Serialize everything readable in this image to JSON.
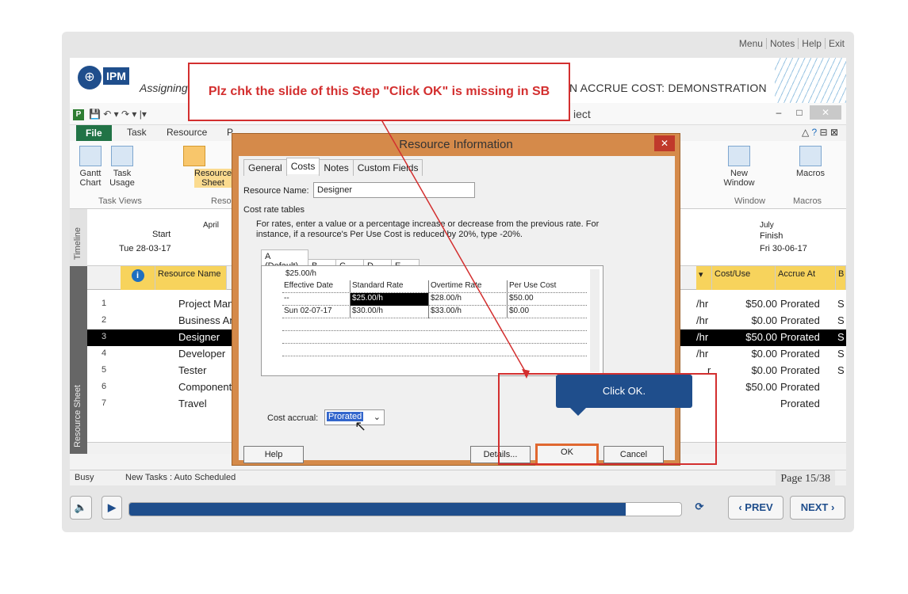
{
  "player": {
    "nav": [
      "Menu",
      "Notes",
      "Help",
      "Exit"
    ],
    "header_title_left": "Assigning",
    "header_title_right": "N ACCRUE COST: DEMONSTRATION",
    "logo_text": "IPM",
    "page": "Page 15/38",
    "prev_label": "‹ PREV",
    "next_label": "NEXT ›",
    "progress_fraction": 0.9
  },
  "app": {
    "window_title_fragment": "iect",
    "tabs": [
      "File",
      "Task",
      "Resource",
      "P"
    ],
    "ribbon": {
      "gantt_chart": "Gantt Chart",
      "task_usage": "Task Usage",
      "resource_sheet": "Resource Sheet",
      "new_window": "New Window",
      "macros": "Macros",
      "group_task_views": "Task Views",
      "group_resource_views": "Reso",
      "group_window": "Window",
      "group_macros": "Macros"
    },
    "timeline": {
      "label": "Timeline",
      "start_label": "Start",
      "start_date": "Tue 28-03-17",
      "april": "April",
      "july": "July",
      "finish_label": "Finish",
      "finish_date": "Fri 30-06-17"
    },
    "sheet": {
      "label": "Resource Sheet",
      "headers": {
        "name": "Resource Name",
        "cost_use": "Cost/Use",
        "accrue_at": "Accrue At",
        "b": "B"
      },
      "rows": [
        {
          "num": "1",
          "name": "Project Mana",
          "rate": "/hr",
          "cost": "$50.00",
          "accrue": "Prorated",
          "b": "S"
        },
        {
          "num": "2",
          "name": "Business Ana",
          "rate": "/hr",
          "cost": "$0.00",
          "accrue": "Prorated",
          "b": "S"
        },
        {
          "num": "3",
          "name": "Designer",
          "rate": "/hr",
          "cost": "$50.00",
          "accrue": "Prorated",
          "b": "S"
        },
        {
          "num": "4",
          "name": "Developer",
          "rate": "/hr",
          "cost": "$0.00",
          "accrue": "Prorated",
          "b": "S"
        },
        {
          "num": "5",
          "name": "Tester",
          "rate": "r",
          "cost": "$0.00",
          "accrue": "Prorated",
          "b": "S"
        },
        {
          "num": "6",
          "name": "Components",
          "rate": "",
          "cost": "$50.00",
          "accrue": "Prorated",
          "b": ""
        },
        {
          "num": "7",
          "name": "Travel",
          "rate": "",
          "cost": "",
          "accrue": "Prorated",
          "b": ""
        }
      ]
    },
    "status": {
      "busy": "Busy",
      "new_tasks": "New Tasks : Auto Scheduled"
    }
  },
  "dialog": {
    "title": "Resource Information",
    "tabs": [
      "General",
      "Costs",
      "Notes",
      "Custom Fields"
    ],
    "resource_name_label": "Resource Name:",
    "resource_name_value": "Designer",
    "cost_rate_tables_label": "Cost rate tables",
    "instructions": "For rates, enter a value or a percentage increase or decrease from the previous rate. For instance, if a resource's Per Use Cost is reduced by 20%, type -20%.",
    "rate_tabs": [
      "A (Default)",
      "B",
      "C",
      "D",
      "E"
    ],
    "entry_value": "$25.00/h",
    "columns": [
      "Effective Date",
      "Standard Rate",
      "Overtime Rate",
      "Per Use Cost"
    ],
    "rows": [
      {
        "date": "--",
        "std": "$25.00/h",
        "ot": "$28.00/h",
        "per": "$50.00"
      },
      {
        "date": "Sun 02-07-17",
        "std": "$30.00/h",
        "ot": "$33.00/h",
        "per": "$0.00"
      }
    ],
    "cost_accrual_label": "Cost accrual:",
    "cost_accrual_value": "Prorated",
    "help": "Help",
    "details": "Details...",
    "ok": "OK",
    "cancel": "Cancel"
  },
  "annotations": {
    "review_note": "Plz chk the slide of this Step \"Click OK\" is missing in SB",
    "callout": "Click OK."
  }
}
